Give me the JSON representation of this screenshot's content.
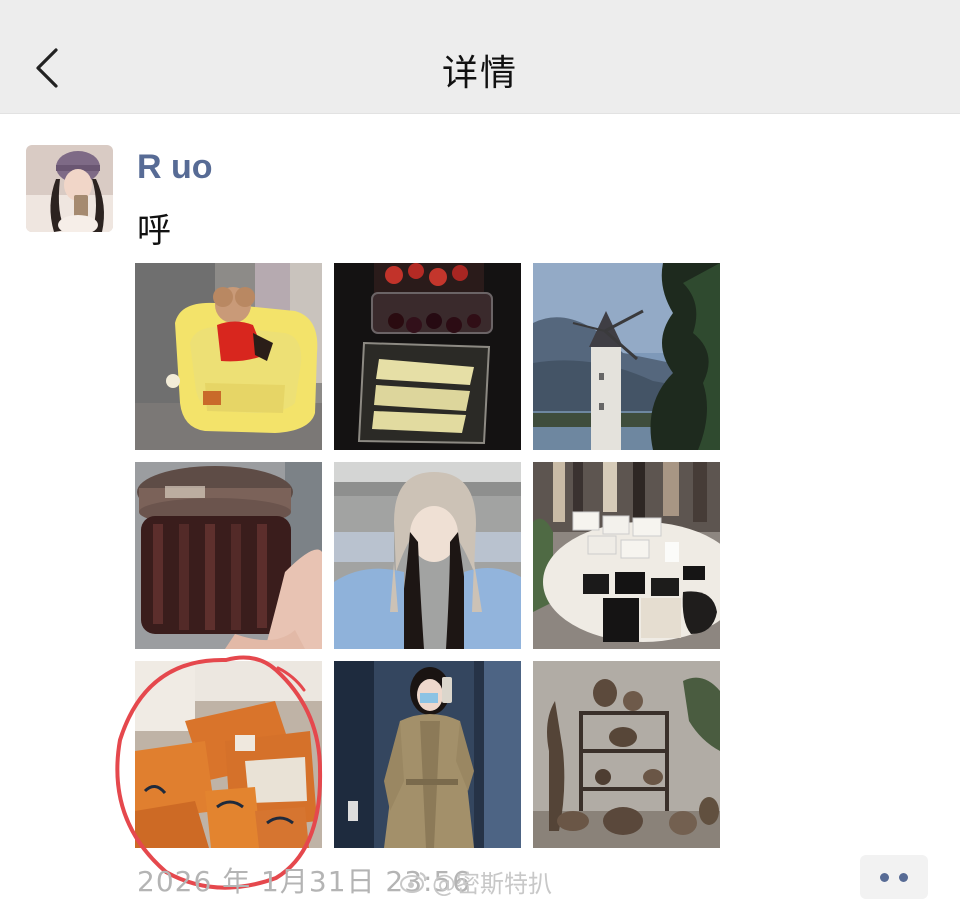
{
  "header": {
    "title": "详情",
    "back_icon": "chevron-left-icon"
  },
  "post": {
    "username": "R uo",
    "text": "呼",
    "timestamp": "2026 年 1月31日 23:56",
    "photo_count": 9
  },
  "photos": [
    {
      "subject": "dog-in-yellow-chair"
    },
    {
      "subject": "fruit-and-cheese-box"
    },
    {
      "subject": "windmill-lake"
    },
    {
      "subject": "jar-in-hand"
    },
    {
      "subject": "girl-in-knit-hat"
    },
    {
      "subject": "store-display-table"
    },
    {
      "subject": "orange-shopping-bags"
    },
    {
      "subject": "mirror-selfie-coat"
    },
    {
      "subject": "pottery-shelf"
    }
  ],
  "watermark": {
    "text": "@密斯特扒",
    "icon": "weibo-icon"
  },
  "annotation": {
    "circle_color": "#e5484d"
  },
  "colors": {
    "link": "#576b95",
    "header_bg": "#ededed",
    "timestamp": "#b4b4b4"
  }
}
